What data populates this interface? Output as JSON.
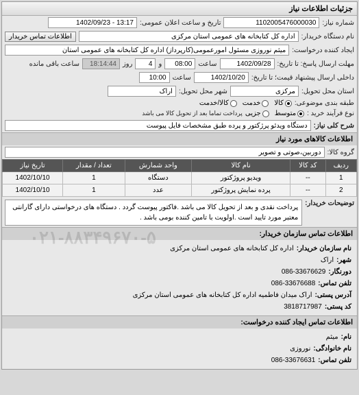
{
  "header": {
    "title": "جزئیات اطلاعات نیاز"
  },
  "top": {
    "lbl_num": "شماره نیاز:",
    "num": "1102005476000030",
    "lbl_date": "تاریخ و ساعت اعلان عمومی:",
    "date": "13:17 - 1402/09/23"
  },
  "buyer": {
    "lbl": "نام دستگاه خریدار:",
    "val": "اداره کل کتابخانه های عمومی استان مرکزی",
    "btn": "اطلاعات تماس خریدار"
  },
  "requester": {
    "lbl": "ایجاد کننده درخواست:",
    "val": "میثم نوروزی مسئول امورعمومی(کارپرداز) اداره کل کتابخانه های عمومی استان"
  },
  "deadline": {
    "lbl1": "مهلت ارسال پاسخ: تا تاریخ:",
    "d1": "1402/09/28",
    "lbl_h": "ساعت",
    "h1": "08:00",
    "and": "و",
    "days": "4",
    "lbl_days": "روز",
    "remain_lbl": "ساعت باقی مانده",
    "remain": "18:14:44",
    "lbl2": "داخلی ارسال پیشنهاد قیمت؛ تا تاریخ:",
    "d2": "1402/10/20",
    "h2": "10:00"
  },
  "location": {
    "lbl_place": "استان محل تحویل:",
    "place": "مرکزی",
    "lbl_city": "شهر محل تحویل:",
    "city": "اراک"
  },
  "class": {
    "lbl": "طبقه بندی موضوعی:",
    "opts": [
      "کالا",
      "خدمت",
      "کالا/خدمت"
    ],
    "selected": 0
  },
  "proc": {
    "lbl": "نوع فرآیند خرید :",
    "opts": [
      "متوسط",
      "جزیی"
    ],
    "selected": 0,
    "note": "پرداخت تماما بعد از تحویل کالا می باشد"
  },
  "subject": {
    "lbl": "شرح کلی نیاز:",
    "val": "دستگاه ویدئو پرژکتور و پرده طبق مشخصات فایل پیوست"
  },
  "goods_title": "اطلاعات کالاهای مورد نیاز",
  "group": {
    "lbl": "گروه کالا:",
    "val": "دوربین،صوتی و تصویر"
  },
  "table": {
    "headers": [
      "ردیف",
      "کد کالا",
      "نام کالا",
      "واحد شمارش",
      "تعداد / مقدار",
      "تاریخ نیاز"
    ],
    "rows": [
      [
        "1",
        "--",
        "ویدیو پروژکتور",
        "دستگاه",
        "1",
        "1402/10/10"
      ],
      [
        "2",
        "--",
        "پرده نمایش پروژکتور",
        "عدد",
        "1",
        "1402/10/10"
      ]
    ]
  },
  "notes": {
    "lbl": "توضیحات خریدار:",
    "val": "پرداخت نقدی و بعد از تحویل کالا می باشد .فاکتور پیوست گردد . دستگاه های درخواستی دارای گارانتی معتبر مورد تایید است .اولویت با تامین کننده بومی باشد ."
  },
  "contact1": {
    "title": "اطلاعات تماس سازمان خریدار:",
    "rows": [
      [
        "نام سازمان خریدار:",
        "اداره کل کتابخانه های عمومی استان مرکزی"
      ],
      [
        "شهر:",
        "اراک"
      ],
      [
        "دورنگار:",
        "086-33676629"
      ],
      [
        "تلفن تماس:",
        "086-33676688"
      ],
      [
        "آدرس پستی:",
        "اراک میدان فاطمیه اداره کل کتابخانه های عمومی استان مرکزی"
      ],
      [
        "کد پستی:",
        "3818717987"
      ]
    ],
    "watermark": "۰۲۱-۸۸۳۴۹۶۷۰-۵"
  },
  "contact2": {
    "title": "اطلاعات تماس ایجاد کننده درخواست:",
    "rows": [
      [
        "نام:",
        "میثم"
      ],
      [
        "نام خانوادگی:",
        "نوروزی"
      ],
      [
        "تلفن تماس:",
        "086-33676631"
      ]
    ]
  }
}
